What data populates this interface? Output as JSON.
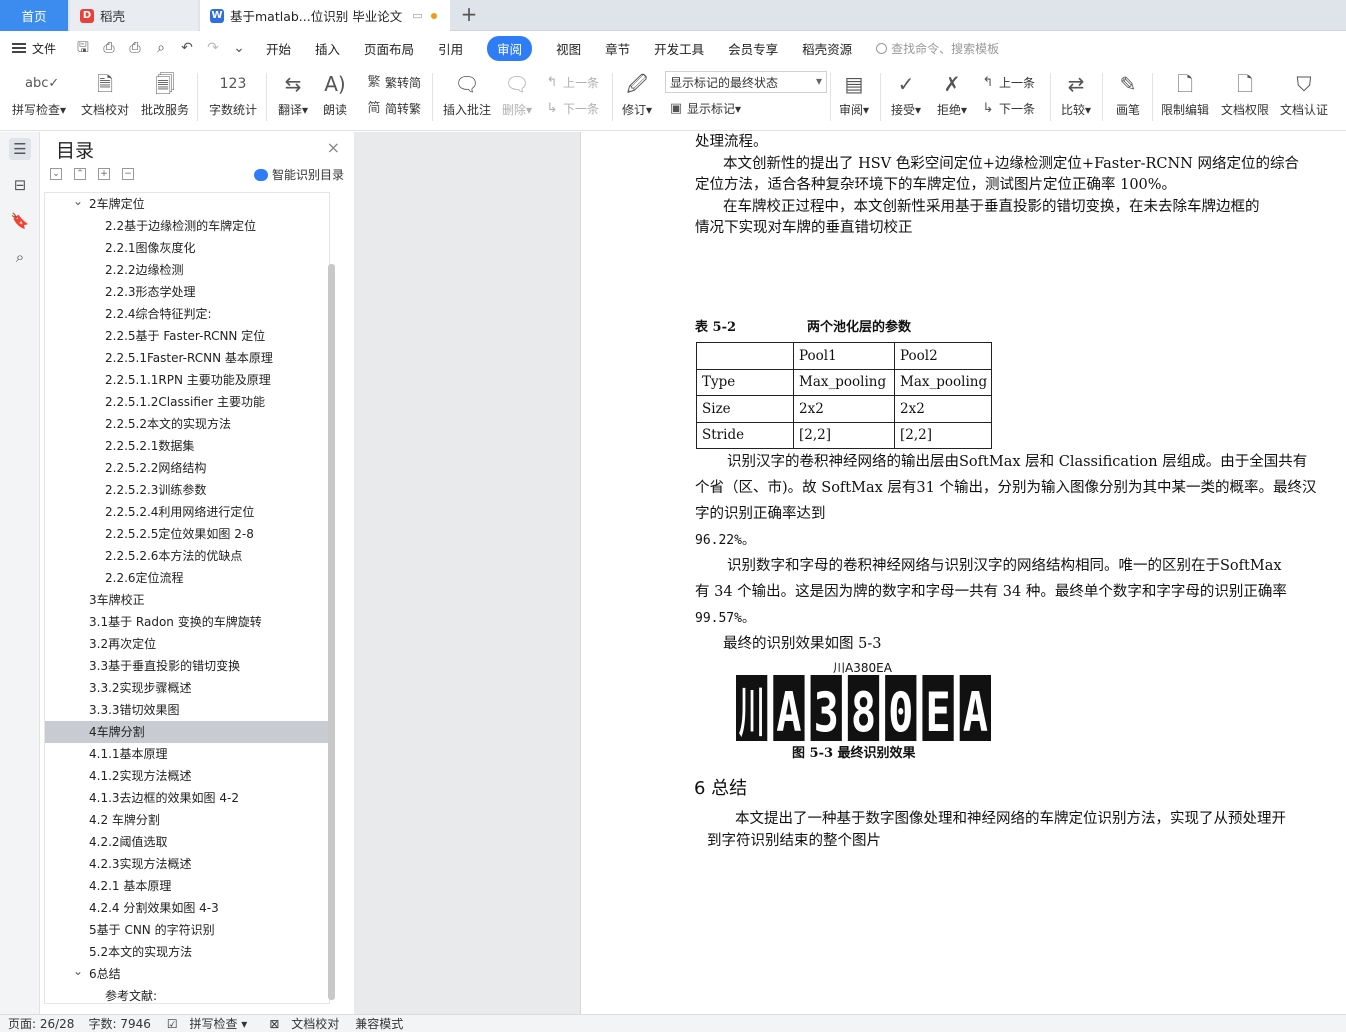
{
  "tabs": {
    "home": "首页",
    "daoke": "稻壳",
    "doc": "基于matlab...位识别 毕业论文"
  },
  "menu": {
    "file": "文件",
    "items": [
      "开始",
      "插入",
      "页面布局",
      "引用",
      "审阅",
      "视图",
      "章节",
      "开发工具",
      "会员专享",
      "稻壳资源"
    ],
    "search_placeholder": "查找命令、搜索模板"
  },
  "ribbon": {
    "spellcheck": "拼写检查",
    "proofread": "文档校对",
    "batch": "批改服务",
    "wordcount": "字数统计",
    "translate": "翻译",
    "read": "朗读",
    "trad": "繁转简",
    "simp": "简转繁",
    "insert_comment": "插入批注",
    "delete": "删除",
    "prev_disabled": "上一条",
    "next_disabled": "下一条",
    "revise": "修订",
    "markup_state": "显示标记的最终状态",
    "show_markup": "显示标记",
    "review": "审阅",
    "accept": "接受",
    "reject": "拒绝",
    "prev": "上一条",
    "next": "下一条",
    "compare": "比较",
    "pen": "画笔",
    "restrict": "限制编辑",
    "permission": "文档权限",
    "certify": "文档认证"
  },
  "toc": {
    "title": "目录",
    "smart": "智能识别目录",
    "items": [
      {
        "text": "2车牌定位",
        "level": 0,
        "arrow": true
      },
      {
        "text": "2.2基于边缘检测的车牌定位",
        "level": 1
      },
      {
        "text": "2.2.1图像灰度化",
        "level": 1
      },
      {
        "text": "2.2.2边缘检测",
        "level": 1
      },
      {
        "text": "2.2.3形态学处理",
        "level": 1
      },
      {
        "text": "2.2.4综合特征判定:",
        "level": 1
      },
      {
        "text": "2.2.5基于 Faster-RCNN 定位",
        "level": 1
      },
      {
        "text": "2.2.5.1Faster-RCNN 基本原理",
        "level": 1
      },
      {
        "text": "2.2.5.1.1RPN 主要功能及原理",
        "level": 1
      },
      {
        "text": "2.2.5.1.2Classifier 主要功能",
        "level": 1
      },
      {
        "text": "2.2.5.2本文的实现方法",
        "level": 1
      },
      {
        "text": "2.2.5.2.1数据集",
        "level": 1
      },
      {
        "text": "2.2.5.2.2网络结构",
        "level": 1
      },
      {
        "text": "2.2.5.2.3训练参数",
        "level": 1
      },
      {
        "text": "2.2.5.2.4利用网络进行定位",
        "level": 1
      },
      {
        "text": "2.2.5.2.5定位效果如图 2-8",
        "level": 1
      },
      {
        "text": "2.2.5.2.6本方法的优缺点",
        "level": 1
      },
      {
        "text": "2.2.6定位流程",
        "level": 1
      },
      {
        "text": "3车牌校正",
        "level": 0
      },
      {
        "text": "3.1基于 Radon 变换的车牌旋转",
        "level": 0
      },
      {
        "text": "3.2再次定位",
        "level": 0
      },
      {
        "text": "3.3基于垂直投影的错切变换",
        "level": 0
      },
      {
        "text": "3.3.2实现步骤概述",
        "level": 0
      },
      {
        "text": "3.3.3错切效果图",
        "level": 0
      },
      {
        "text": "4车牌分割",
        "level": 0,
        "selected": true
      },
      {
        "text": "4.1.1基本原理",
        "level": 0
      },
      {
        "text": "4.1.2实现方法概述",
        "level": 0
      },
      {
        "text": "4.1.3去边框的效果如图 4-2",
        "level": 0
      },
      {
        "text": "4.2 车牌分割",
        "level": 0
      },
      {
        "text": "4.2.2阈值选取",
        "level": 0
      },
      {
        "text": "4.2.3实现方法概述",
        "level": 0
      },
      {
        "text": "4.2.1 基本原理",
        "level": 0
      },
      {
        "text": "4.2.4 分割效果如图 4-3",
        "level": 0
      },
      {
        "text": "5基于 CNN 的字符识别",
        "level": 0
      },
      {
        "text": "5.2本文的实现方法",
        "level": 0
      },
      {
        "text": "6总结",
        "level": 0,
        "arrow": true
      },
      {
        "text": "参考文献:",
        "level": 1
      }
    ]
  },
  "doc": {
    "line1": "处理流程。",
    "line2": "本文创新性的提出了  HSV 色彩空间定位+边缘检测定位+Faster-RCNN 网络定位的综合",
    "line3": "定位方法，适合各种复杂环境下的车牌定位，测试图片定位正确率 100%。",
    "line4": "在车牌校正过程中，本文创新性采用基于垂直投影的错切变换，在未去除车牌边框的",
    "line5": "情况下实现对车牌的垂直错切校正",
    "table_caption_num": "表 5-2",
    "table_caption": "两个池化层的参数",
    "table": [
      [
        "",
        "Pool1",
        "Pool2"
      ],
      [
        "Type",
        "Max_pooling",
        "Max_pooling"
      ],
      [
        "Size",
        "2x2",
        "2x2"
      ],
      [
        "Stride",
        "[2,2]",
        "[2,2]"
      ]
    ],
    "p1a": "识别汉字的卷积神经网络的输出层由SoftMax 层和  Classification 层组成。由于全国共有",
    "p1b": "个省（区、市)。故 SoftMax 层有31 个输出，分别为输入图像分别为其中某一类的概率。最终汉",
    "p1c": "字的识别正确率达到",
    "p1d": "96.22%。",
    "p2a": "识别数字和字母的卷积神经网络与识别汉字的网络结构相同。唯一的区别在于SoftMax",
    "p2b": "有  34 个输出。这是因为牌的数字和字母一共有  34 种。最终单个数字和字字母的识别正确率",
    "p2c": "99.57%。",
    "p3": "最终的识别效果如图  5-3",
    "plate_label": "川A380EA",
    "plate_chars": [
      "川",
      "A",
      "3",
      "8",
      "0",
      "E",
      "A"
    ],
    "figure_caption": "图  5-3 最终识别效果",
    "heading": "6   总结",
    "p4a": "本文提出了一种基于数字图像处理和神经网络的车牌定位识别方法，实现了从预处理开",
    "p4b": "到字符识别结束的整个图片"
  },
  "status": {
    "page": "页面: 26/28",
    "words": "字数: 7946",
    "spell": "拼写检查",
    "proof": "文档校对",
    "compat": "兼容模式"
  }
}
